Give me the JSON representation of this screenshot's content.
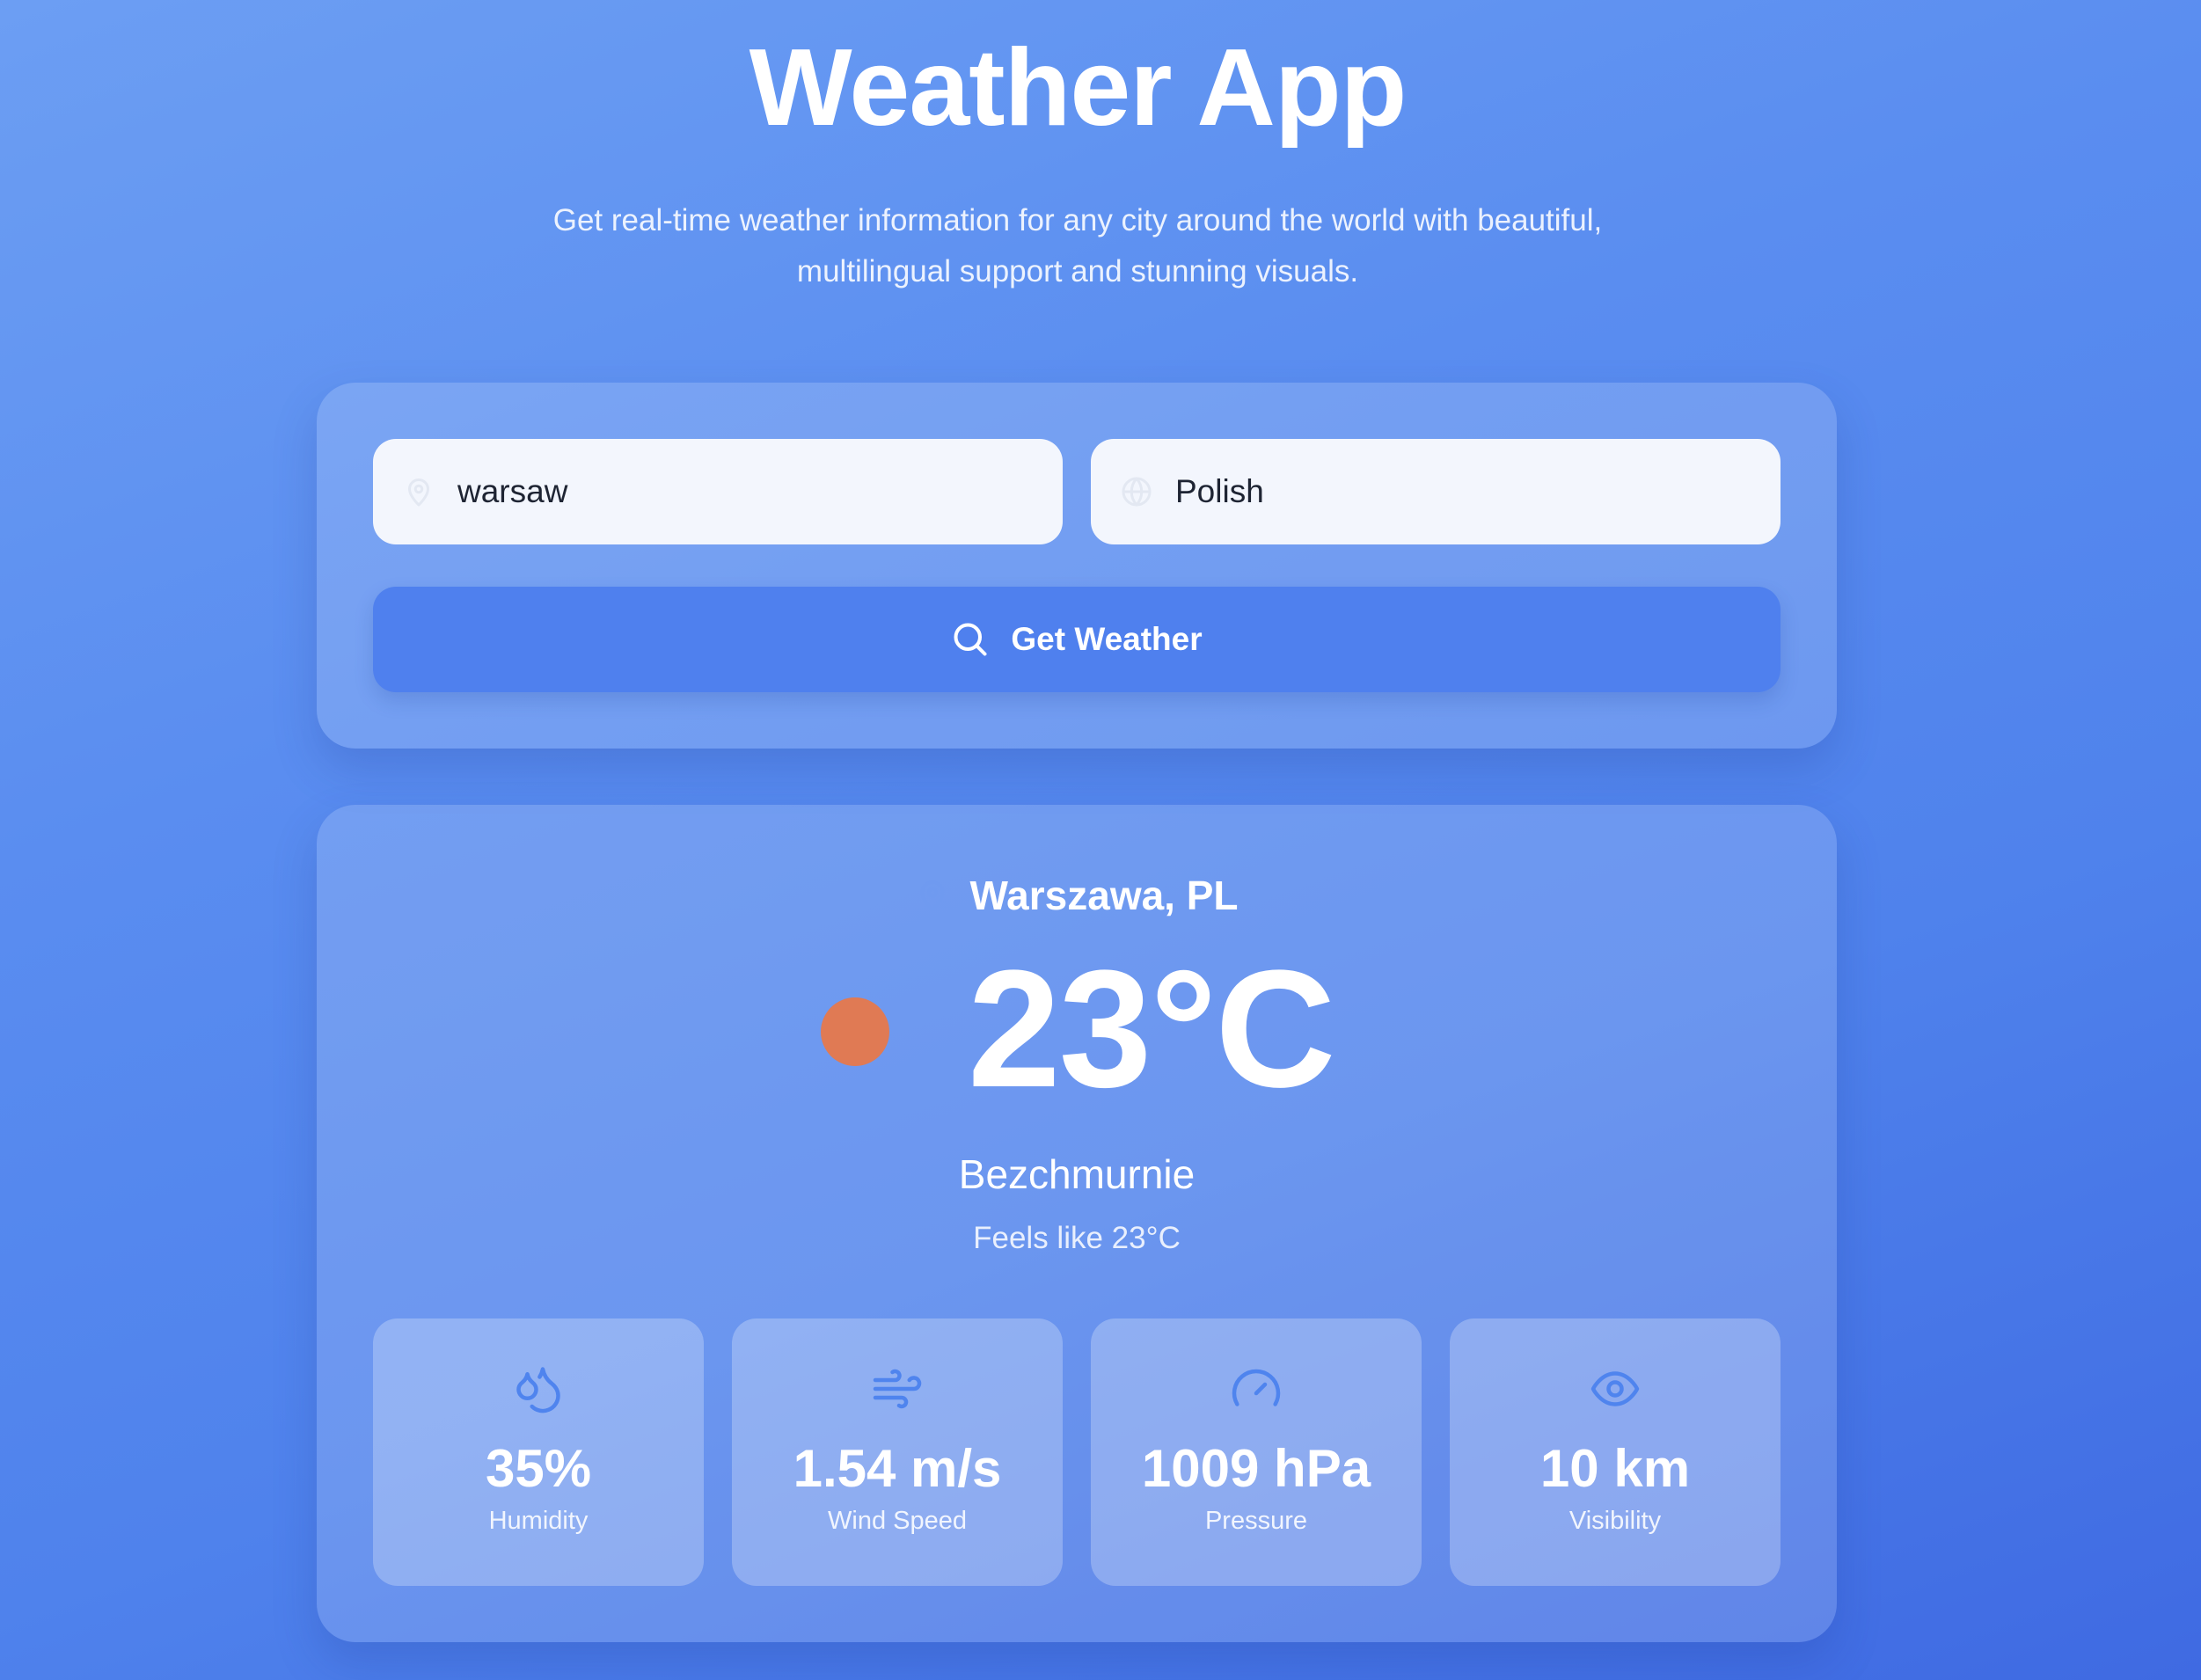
{
  "header": {
    "title": "Weather App",
    "subtitle_line1": "Get real-time weather information for any city around the world with beautiful,",
    "subtitle_line2": "multilingual support and stunning visuals."
  },
  "search": {
    "city_value": "warsaw",
    "city_icon": "map-pin-icon",
    "language_value": "Polish",
    "language_icon": "globe-icon",
    "button_label": "Get Weather",
    "button_icon": "search-icon"
  },
  "weather": {
    "location": "Warszawa, PL",
    "location_icon": "map-pin-icon",
    "condition_icon": "sun-icon",
    "temperature": "23°C",
    "description": "Bezchmurnie",
    "feels_like": "Feels like 23°C",
    "stats": [
      {
        "icon": "droplets-icon",
        "value": "35%",
        "label": "Humidity"
      },
      {
        "icon": "wind-icon",
        "value": "1.54 m/s",
        "label": "Wind Speed"
      },
      {
        "icon": "gauge-icon",
        "value": "1009 hPa",
        "label": "Pressure"
      },
      {
        "icon": "eye-icon",
        "value": "10 km",
        "label": "Visibility"
      }
    ]
  },
  "colors": {
    "background_start": "#6c9ef3",
    "background_end": "#3f6ae2",
    "button": "#4f80ee",
    "input_bg": "#f3f6fd",
    "sun": "#e07a54",
    "stat_icon": "#4f84ee"
  }
}
